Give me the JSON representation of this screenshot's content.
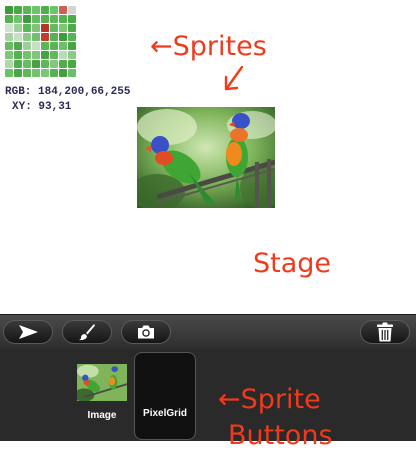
{
  "stage": {
    "rgb_readout": "RGB: 184,200,66,255",
    "xy_readout": "XY: 93,31",
    "pixel_colors": [
      [
        "#3e9a3a",
        "#4aa845",
        "#5cb658",
        "#6ac666",
        "#52ad4f",
        "#6bc467",
        "#cf5e4e",
        "#cfd6cf"
      ],
      [
        "#55b150",
        "#6ec46a",
        "#41993e",
        "#64bd5f",
        "#56b252",
        "#5fb95b",
        "#55b050",
        "#4cab48"
      ],
      [
        "#cfe3cc",
        "#9fcf9a",
        "#5ab756",
        "#7fc37a",
        "#b73227",
        "#63bb5e",
        "#79c874",
        "#4ea94a"
      ],
      [
        "#a8d4a3",
        "#c7dfc4",
        "#8cc987",
        "#74bf6f",
        "#c33a2e",
        "#57b053",
        "#3f9a3c",
        "#58b354"
      ],
      [
        "#69bb64",
        "#4fa94b",
        "#9bd096",
        "#c6e0c3",
        "#5cb557",
        "#5bb456",
        "#6cc067",
        "#4aa446"
      ],
      [
        "#7cc777",
        "#56b151",
        "#70c56b",
        "#80c57b",
        "#48a145",
        "#62b85d",
        "#b8dcb4",
        "#8ccb87"
      ],
      [
        "#aed6a9",
        "#4fae4b",
        "#66be61",
        "#47a244",
        "#60b75b",
        "#83c77f",
        "#52ac4e",
        "#4aa746"
      ],
      [
        "#6bc166",
        "#4aa646",
        "#5db958",
        "#6fc36a",
        "#7ac875",
        "#56b152",
        "#43a040",
        "#6bbf66"
      ]
    ]
  },
  "annotations": {
    "sprites": "←Sprites",
    "stage": "Stage",
    "sprite_buttons_line1": "←Sprite",
    "sprite_buttons_line2": "Buttons"
  },
  "toolbar": {
    "select_icon": "arrow-pointer-icon",
    "paint_icon": "paintbrush-icon",
    "camera_icon": "camera-icon",
    "trash_icon": "trash-icon"
  },
  "tray": {
    "buttons": [
      {
        "label": "Image"
      },
      {
        "label": "PixelGrid"
      }
    ]
  },
  "colors": {
    "annotation": "#ef3a1c",
    "toolbar": "#3a3a3a",
    "tray": "#2a2a2a"
  }
}
